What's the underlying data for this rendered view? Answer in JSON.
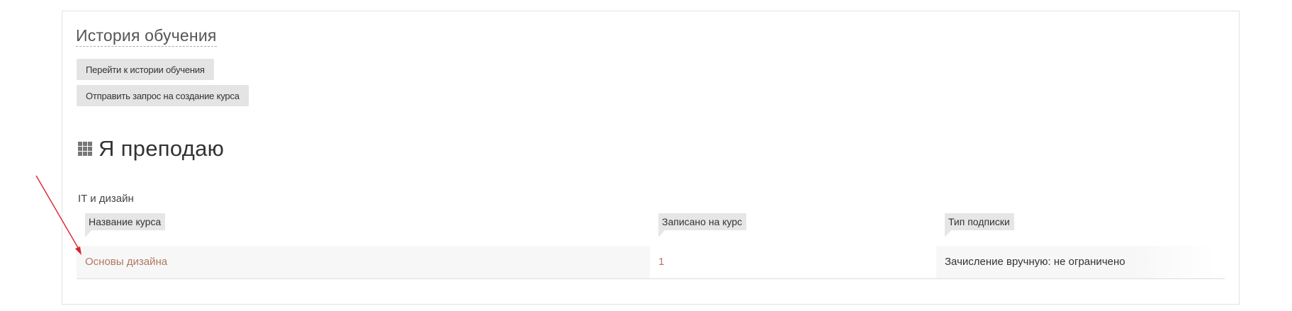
{
  "history": {
    "title": "История обучения",
    "go_history_button": "Перейти к истории обучения",
    "request_course_button": "Отправить запрос на создание курса"
  },
  "teaching": {
    "title": "Я преподаю",
    "icon": "grid-icon",
    "category": "IT и дизайн",
    "columns": {
      "name": "Название курса",
      "enrolled": "Записано на курс",
      "subscription": "Тип подписки"
    },
    "rows": [
      {
        "name": "Основы дизайна",
        "enrolled": "1",
        "subscription": "Зачисление вручную: не ограничено"
      }
    ]
  },
  "colors": {
    "link": "#b07764",
    "annotation_arrow": "#d9232d",
    "button_bg": "#e4e4e4",
    "header_bg": "#e6e6e6"
  }
}
